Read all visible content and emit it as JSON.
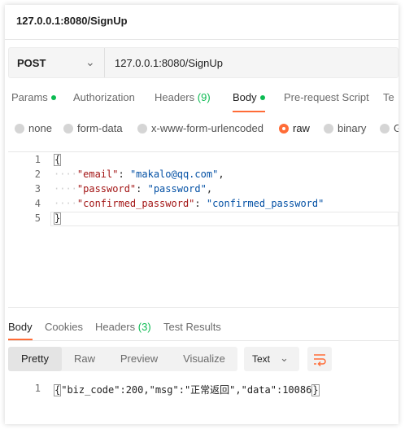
{
  "request": {
    "title": "127.0.0.1:8080/SignUp",
    "method": "POST",
    "url": "127.0.0.1:8080/SignUp"
  },
  "request_tabs": [
    {
      "label": "Params",
      "has_dot": true
    },
    {
      "label": "Authorization"
    },
    {
      "label": "Headers",
      "count": "(9)"
    },
    {
      "label": "Body",
      "has_dot": true,
      "active": true
    },
    {
      "label": "Pre-request Script"
    },
    {
      "label": "Te"
    }
  ],
  "body_types": [
    {
      "label": "none"
    },
    {
      "label": "form-data"
    },
    {
      "label": "x-www-form-urlencoded"
    },
    {
      "label": "raw",
      "selected": true
    },
    {
      "label": "binary"
    },
    {
      "label": "G"
    }
  ],
  "editor": {
    "lines": [
      {
        "num": "1",
        "text": "{"
      },
      {
        "num": "2",
        "key": "\"email\"",
        "sep": ": ",
        "value": "\"makalo@qq.com\"",
        "tail": ","
      },
      {
        "num": "3",
        "key": "\"password\"",
        "sep": ": ",
        "value": "\"password\"",
        "tail": ","
      },
      {
        "num": "4",
        "key": "\"confirmed_password\"",
        "sep": ": ",
        "value": "\"confirmed_password\"",
        "tail": ""
      },
      {
        "num": "5",
        "text": "}"
      }
    ]
  },
  "response_tabs": [
    {
      "label": "Body",
      "active": true
    },
    {
      "label": "Cookies"
    },
    {
      "label": "Headers",
      "count": "(3)"
    },
    {
      "label": "Test Results"
    }
  ],
  "view_modes": [
    {
      "label": "Pretty",
      "active": true
    },
    {
      "label": "Raw"
    },
    {
      "label": "Preview"
    },
    {
      "label": "Visualize"
    }
  ],
  "format": {
    "label": "Text"
  },
  "response": {
    "line_num": "1",
    "open": "{",
    "content": "\"biz_code\":200,\"msg\":\"正常返回\",\"data\":10086",
    "close": "}"
  },
  "colors": {
    "accent": "#ff6c37",
    "dot": "#0cbb52"
  },
  "icons": {
    "method_dropdown": "chevron-down-icon",
    "format_dropdown": "chevron-down-icon",
    "wrap": "wrap-lines-icon"
  }
}
